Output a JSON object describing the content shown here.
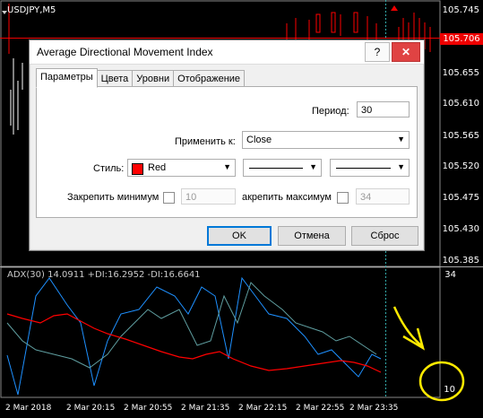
{
  "chart": {
    "symbol": "USDJPY,M5",
    "price_labels": [
      "105.745",
      "105.706",
      "105.655",
      "105.610",
      "105.565",
      "105.520",
      "105.475",
      "105.430",
      "105.385"
    ],
    "current_price": "105.706",
    "indicator_label": "ADX(30) 14.0911 +DI:16.2952 -DI:16.6641",
    "indicator_scale_top": "34",
    "indicator_scale_bottom": "10",
    "time_labels": [
      "2 Mar 2018",
      "2 Mar 20:15",
      "2 Mar 20:55",
      "2 Mar 21:35",
      "2 Mar 22:15",
      "2 Mar 22:55",
      "2 Mar 23:35"
    ],
    "colors": {
      "adx": "#1e90ff",
      "plus_di": "#5f9ea0",
      "minus_di": "#ff0000",
      "annotation": "#ffff00"
    }
  },
  "dialog": {
    "title": "Average Directional Movement Index",
    "help_label": "?",
    "close_label": "✕",
    "tabs": [
      {
        "label": "Параметры",
        "active": true
      },
      {
        "label": "Цвета",
        "active": false
      },
      {
        "label": "Уровни",
        "active": false
      },
      {
        "label": "Отображение",
        "active": false
      }
    ],
    "period_label": "Период:",
    "period_value": "30",
    "apply_label": "Применить к:",
    "apply_value": "Close",
    "style_label": "Стиль:",
    "style_color_name": "Red",
    "fix_min_label": "Закрепить минимум",
    "fix_min_value": "10",
    "fix_max_label": "акрепить максимум",
    "fix_max_value": "34",
    "ok_label": "OK",
    "cancel_label": "Отмена",
    "reset_label": "Сброс"
  }
}
